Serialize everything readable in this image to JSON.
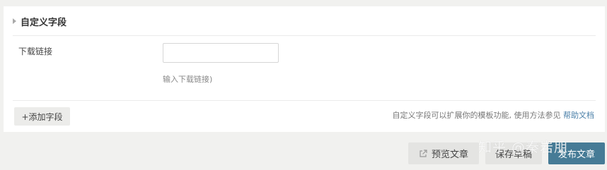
{
  "custom_fields": {
    "title": "自定义字段",
    "field": {
      "label": "下载链接",
      "value": "",
      "placeholder": "",
      "hint": "输入下载链接)"
    },
    "add_field_label": "+添加字段",
    "info_text": "自定义字段可以扩展你的模板功能, 使用方法参见 ",
    "help_link": "帮助文档"
  },
  "actions": {
    "preview_label": "预览文章",
    "save_label": "保存草稿",
    "publish_label": "发布文章"
  },
  "watermark": "知乎 @秦岩朋",
  "colors": {
    "primary": "#467b96",
    "background": "#f1f1ef",
    "link": "#4a7fa8"
  },
  "icons": {
    "collapse": "triangle-right-icon",
    "preview": "external-link-icon"
  }
}
